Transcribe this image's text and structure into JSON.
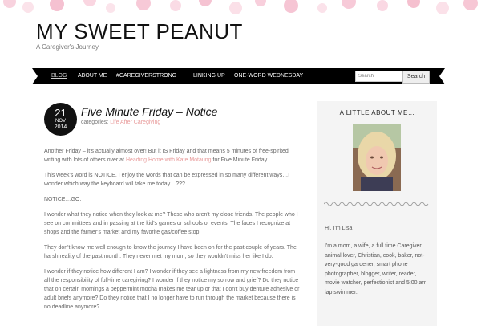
{
  "site": {
    "title": "MY SWEET PEANUT",
    "tagline": "A Caregiver's Journey"
  },
  "nav": {
    "items": [
      {
        "label": "Blog",
        "active": true
      },
      {
        "label": "About Me",
        "active": false
      },
      {
        "label": "#CaregiverStrong",
        "active": false
      },
      {
        "label": "Linking Up",
        "active": false
      },
      {
        "label": "One-Word Wednesday",
        "active": false
      }
    ],
    "search_placeholder": "Search",
    "search_button": "Search"
  },
  "post": {
    "date_day": "21",
    "date_month": "NOV",
    "date_year": "2014",
    "title": "Five Minute Friday – Notice",
    "categories_label": "categories:",
    "category": "Life After Caregiving",
    "p1_before": "Another Friday – it's actually almost over!  But it IS Friday and that means 5 minutes of free-spirited writing with lots of others over at ",
    "p1_link": "Heading Home with Kate Motaung",
    "p1_after": " for Five Minute Friday.",
    "p2": "This week's word is NOTICE.  I enjoy the words that can be expressed in so many different ways…I wonder which way the keyboard will take me today…???",
    "p3": "NOTICE…GO:",
    "p4": "I wonder what they notice when they look at me?  Those who aren't my close friends.  The people who I see on committees and in passing at the kid's games or schools or events.  The faces I recognize at shops and the farmer's market and my favorite gas/coffee stop.",
    "p5": "They don't know me well enough to know the journey I have been on for the past couple of years.  The harsh reality of the past month.  They never met my mom, so they wouldn't miss her like I do.",
    "p6": "I wonder if they notice how different I am?  I wonder if they see a lightness from my new freedom from all the responsibility of full-time caregiving?  I wonder if they notice my sorrow and grief?  Do they notice that on certain mornings a peppermint mocha makes me tear up or that I don't buy denture adhesive or adult briefs anymore?  Do they notice that I no longer have to run through the market because there is no deadline anymore?"
  },
  "sidebar": {
    "heading": "A LITTLE ABOUT ME…",
    "greeting": "Hi, I'm Lisa",
    "bio": "I'm a mom, a wife, a full time Caregiver, animal lover, Christian, cook, baker, not-very-good gardener, smart phone photographer, blogger, writer, reader, movie watcher, perfectionist and 5:00 am lap swimmer."
  },
  "colors": {
    "accent_link": "#e89a9a",
    "nav_bg": "#000000",
    "sidebar_bg": "#f4f4f4",
    "dots": "#f7c6d6"
  }
}
